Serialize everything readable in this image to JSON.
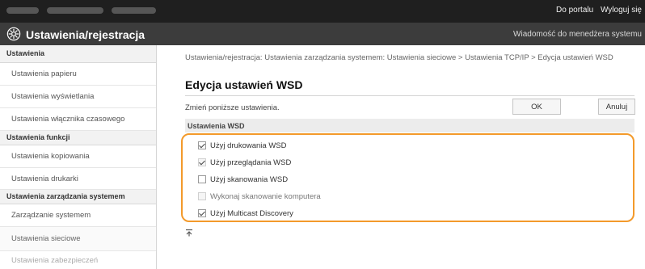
{
  "topbar": {
    "portal_link": "Do portalu",
    "logout_link": "Wyloguj się"
  },
  "app": {
    "title": "Ustawienia/rejestracja",
    "message_link": "Wiadomość do menedżera systemu"
  },
  "sidebar": {
    "sections": [
      {
        "header": "Ustawienia",
        "items": [
          "Ustawienia papieru",
          "Ustawienia wyświetlania",
          "Ustawienia włącznika czasowego"
        ]
      },
      {
        "header": "Ustawienia funkcji",
        "items": [
          "Ustawienia kopiowania",
          "Ustawienia drukarki"
        ]
      },
      {
        "header": "Ustawienia zarządzania systemem",
        "items": [
          "Zarządzanie systemem",
          "Ustawienia sieciowe",
          "Ustawienia zabezpieczeń"
        ]
      }
    ]
  },
  "main": {
    "breadcrumb": "Ustawienia/rejestracja: Ustawienia zarządzania systemem: Ustawienia sieciowe > Ustawienia TCP/IP > Edycja ustawień WSD",
    "title": "Edycja ustawień WSD",
    "instruction": "Zmień poniższe ustawienia.",
    "ok_label": "OK",
    "cancel_label": "Anuluj",
    "section_header": "Ustawienia WSD",
    "options": [
      {
        "label": "Użyj drukowania WSD",
        "checked": true,
        "enabled": true
      },
      {
        "label": "Użyj przeglądania WSD",
        "checked": true,
        "enabled": false
      },
      {
        "label": "Użyj skanowania WSD",
        "checked": false,
        "enabled": true
      },
      {
        "label": "Wykonaj skanowanie komputera",
        "checked": false,
        "enabled": false
      },
      {
        "label": "Użyj Multicast Discovery",
        "checked": true,
        "enabled": true
      }
    ]
  },
  "colors": {
    "highlight": "#f39a2b",
    "topbar": "#1f1f1f",
    "secondbar": "#3c3c3c"
  },
  "icons": {
    "app": "settings-gear-icon",
    "back_to_top": "arrow-to-top-icon"
  }
}
